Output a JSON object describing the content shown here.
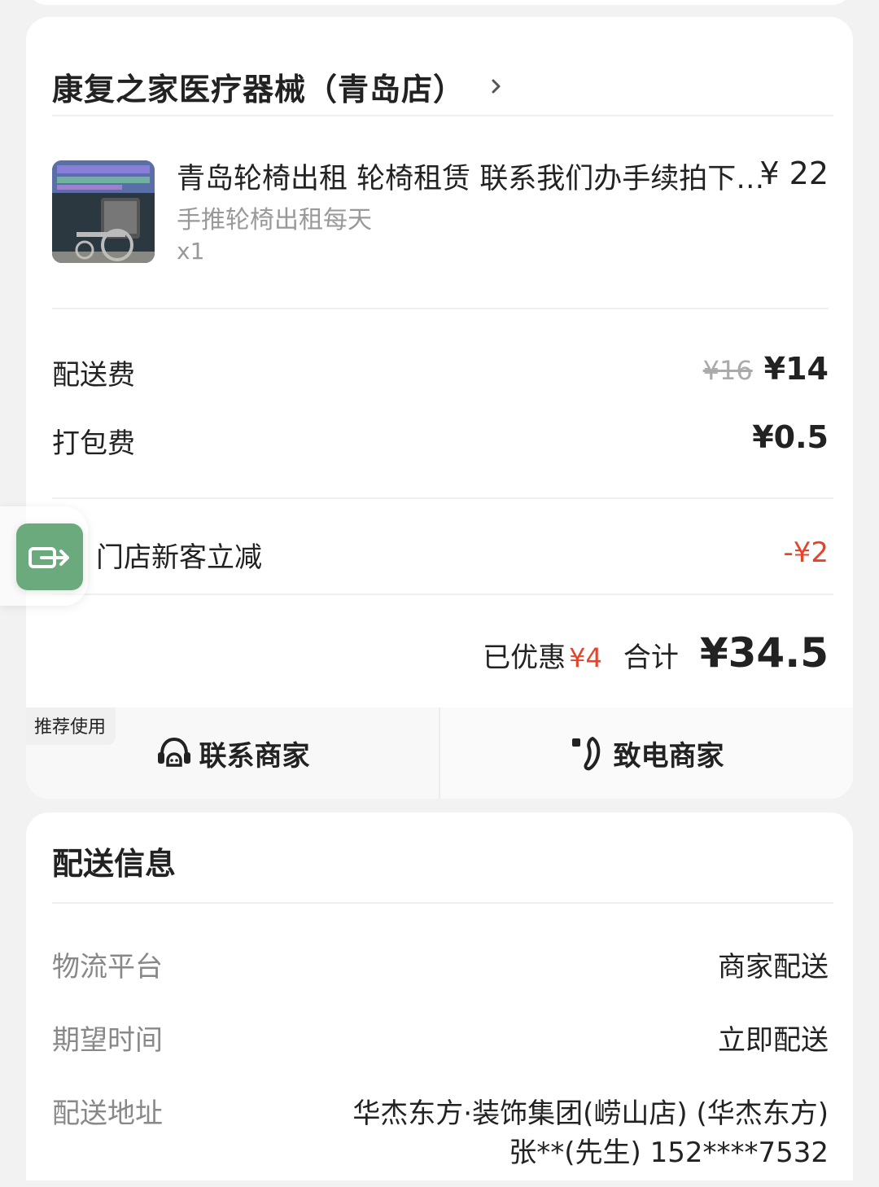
{
  "order": {
    "shop_name": "康复之家医疗器械（青岛店）",
    "product": {
      "title": "青岛轮椅出租 轮椅租赁 联系我们办手续拍下…",
      "price": "¥ 22",
      "spec": "手推轮椅出租每天",
      "quantity": "x1"
    },
    "fees": {
      "delivery_label": "配送费",
      "delivery_original": "¥16",
      "delivery_price": "¥14",
      "packing_label": "打包费",
      "packing_price": "¥0.5"
    },
    "promo": {
      "label": "门店新客立减",
      "value": "-¥2"
    },
    "total": {
      "saved_label": "已优惠",
      "saved_value": "¥4",
      "sum_label": "合计",
      "sum_value": "¥34.5"
    },
    "actions": {
      "recommend_tag": "推荐使用",
      "contact_label": "联系商家",
      "call_label": "致电商家"
    }
  },
  "delivery_info": {
    "title": "配送信息",
    "platform_label": "物流平台",
    "platform_value": "商家配送",
    "time_label": "期望时间",
    "time_value": "立即配送",
    "address_label": "配送地址",
    "address_line1": "华杰东方·装饰集团(崂山店) (华杰东方)",
    "address_line2": "张**(先生) 152****7532"
  },
  "colors": {
    "accent_red": "#e5432a",
    "float_button": "#6aaa7c",
    "background": "#f2f2f2"
  }
}
